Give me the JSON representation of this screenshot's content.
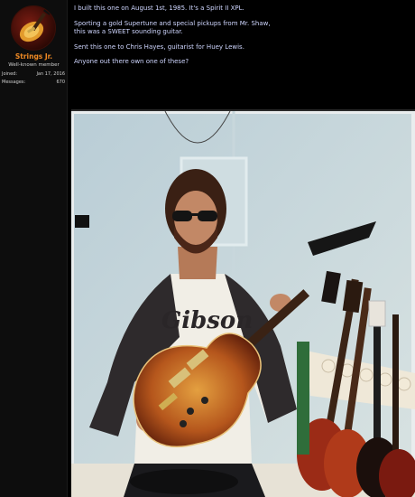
{
  "user": {
    "name": "Strings Jr.",
    "title": "Well-known member",
    "joined_label": "Joined:",
    "joined_value": "Jan 17, 2016",
    "messages_label": "Messages:",
    "messages_value": "670"
  },
  "post": {
    "paragraphs": [
      [
        "I built this one on August 1st, 1985. It's a Spirit II XPL."
      ],
      [
        "Sporting a gold Supertune and special pickups from Mr. Shaw,",
        "this was a SWEET sounding guitar."
      ],
      [
        "Sent this one to Chris Hayes, guitarist for Huey Lewis."
      ],
      [
        "Anyone out there own one of these?"
      ]
    ]
  },
  "photo": {
    "shirt_logo_text": "Gibson"
  }
}
